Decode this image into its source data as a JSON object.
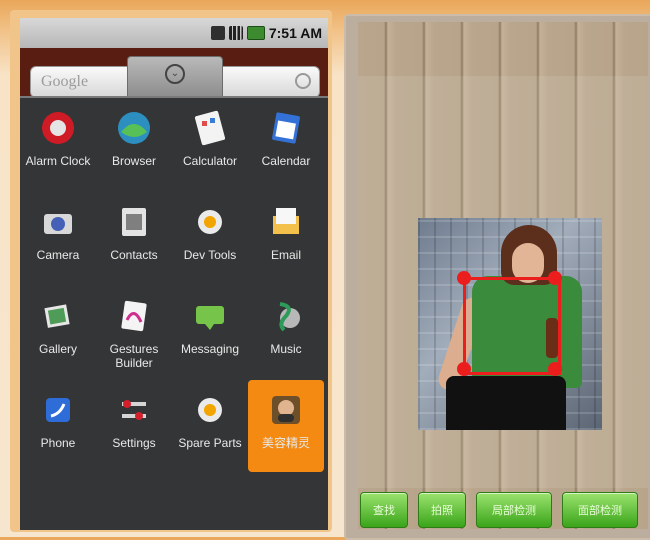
{
  "status_bar": {
    "time": "7:51 AM"
  },
  "search": {
    "brand": "Google"
  },
  "apps": [
    {
      "label": "Alarm Clock",
      "icon": "alarm-clock-icon"
    },
    {
      "label": "Browser",
      "icon": "browser-icon"
    },
    {
      "label": "Calculator",
      "icon": "calculator-icon"
    },
    {
      "label": "Calendar",
      "icon": "calendar-icon"
    },
    {
      "label": "Camera",
      "icon": "camera-icon"
    },
    {
      "label": "Contacts",
      "icon": "contacts-icon"
    },
    {
      "label": "Dev Tools",
      "icon": "gear-icon"
    },
    {
      "label": "Email",
      "icon": "email-icon"
    },
    {
      "label": "Gallery",
      "icon": "gallery-icon"
    },
    {
      "label": "Gestures Builder",
      "icon": "gestures-icon"
    },
    {
      "label": "Messaging",
      "icon": "messaging-icon"
    },
    {
      "label": "Music",
      "icon": "music-icon"
    },
    {
      "label": "Phone",
      "icon": "phone-icon"
    },
    {
      "label": "Settings",
      "icon": "settings-icon"
    },
    {
      "label": "Spare Parts",
      "icon": "gear-icon"
    },
    {
      "label": "美容精灵",
      "icon": "beauty-app-icon"
    }
  ],
  "buttons": [
    "查找",
    "拍照",
    "局部检测",
    "面部检测"
  ],
  "colors": {
    "drawer_bg": "#333536",
    "selected_app": "#f48a12",
    "button_green": "#3aa41a",
    "detection_red": "#ec1d1d"
  }
}
